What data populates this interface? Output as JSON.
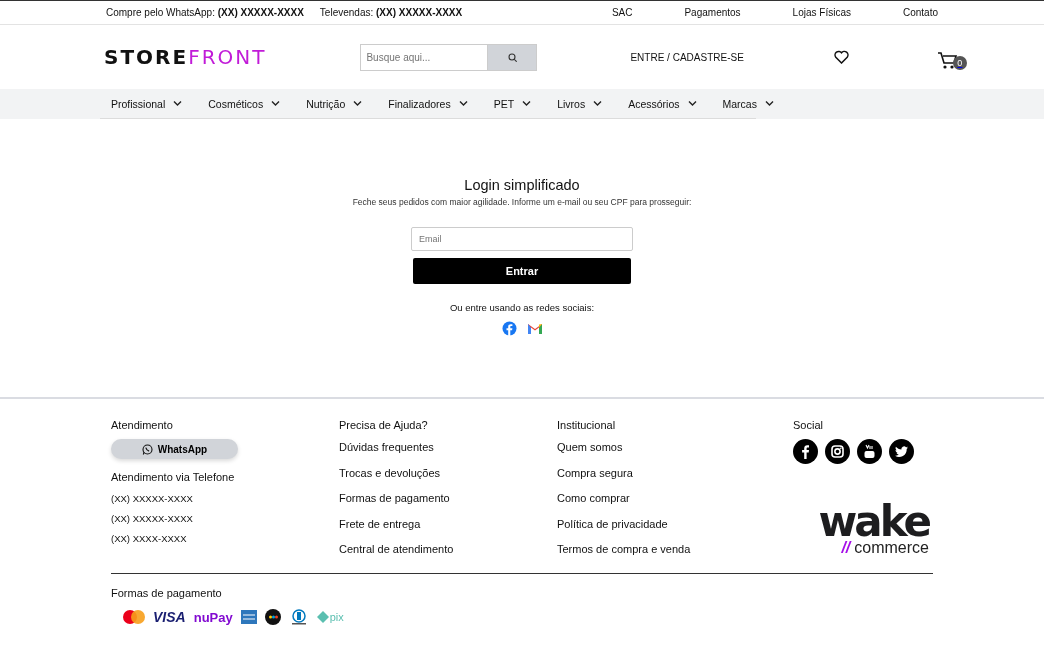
{
  "top_bar": {
    "contacts": [
      {
        "label": "Compre pelo WhatsApp:",
        "value": "(XX) XXXXX-XXXX"
      },
      {
        "label": "Televendas:",
        "value": "(XX) XXXXX-XXXX"
      }
    ],
    "links": [
      "SAC",
      "Pagamentos",
      "Lojas Físicas",
      "Contato"
    ]
  },
  "header": {
    "logo": {
      "dark": "STORE",
      "accent": "FRONT"
    },
    "search": {
      "placeholder": "Busque aqui..."
    },
    "account_link": "ENTRE / CADASTRE-SE",
    "cart_count": "0"
  },
  "categories": [
    "Profissional",
    "Cosméticos",
    "Nutrição",
    "Finalizadores",
    "PET",
    "Livros",
    "Acessórios",
    "Marcas"
  ],
  "login": {
    "title": "Login simplificado",
    "subtitle": "Feche seus pedidos com maior agilidade. Informe um e-mail ou seu CPF para prosseguir:",
    "email_field": {
      "placeholder": "Email"
    },
    "submit": "Entrar",
    "social_prompt": "Ou entre usando as redes sociais:"
  },
  "footer": {
    "support": {
      "title": "Atendimento",
      "whatsapp_button": "WhatsApp",
      "phone_title": "Atendimento via Telefone",
      "phones": [
        "(XX) XXXXX-XXXX",
        "(XX) XXXXX-XXXX",
        "(XX) XXXX-XXXX"
      ]
    },
    "help": {
      "title": "Precisa de Ajuda?",
      "links": [
        "Dúvidas frequentes",
        "Trocas e devoluções",
        "Formas de pagamento",
        "Frete de entrega",
        "Central de atendimento"
      ]
    },
    "institutional": {
      "title": "Institucional",
      "links": [
        "Quem somos",
        "Compra segura",
        "Como comprar",
        "Política de privacidade",
        "Termos de compra e venda"
      ]
    },
    "social": {
      "title": "Social"
    },
    "brand": {
      "name": "wake",
      "slashes": "//",
      "tagline": "commerce"
    },
    "payments": {
      "title": "Formas de pagamento",
      "methods": [
        {
          "kind": "mastercard"
        },
        {
          "kind": "visa",
          "label": "VISA"
        },
        {
          "kind": "nupay",
          "label": "nuPay"
        },
        {
          "kind": "amex"
        },
        {
          "kind": "elo"
        },
        {
          "kind": "diners"
        },
        {
          "kind": "pix",
          "label": "pix"
        }
      ]
    }
  }
}
